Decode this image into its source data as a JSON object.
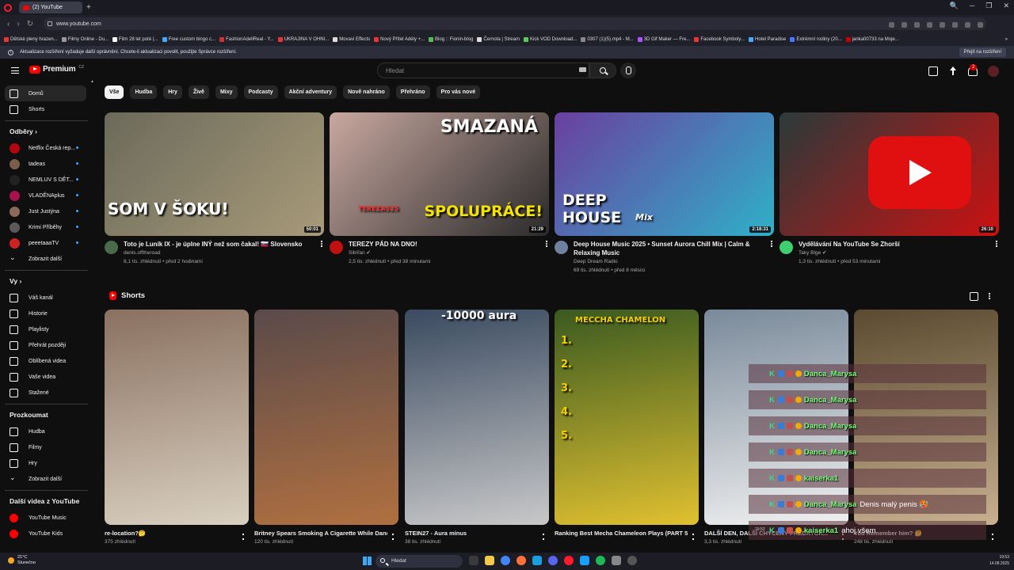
{
  "browser": {
    "tab_title": "(2) YouTube",
    "new_tab": "+",
    "url": "www.youtube.com",
    "window_controls": [
      "🔍",
      "─",
      "❐",
      "✕"
    ],
    "bookmarks": [
      "Dětské pleny hrazen...",
      "Filmy Online - Du...",
      "Film 28 let poté (...",
      "Free custom bingo c...",
      "FashionAdellReal - Y...",
      "UKRAJINA V OHNI...",
      "Movavi Effects",
      "Nový Přítel Adély +...",
      "Blog :: Fionin-blog",
      "Černota | Stream",
      "Kick VOD Download...",
      "0307 (1)(5).mp4 - M...",
      "3D Gif Maker — Fre...",
      "Facebook Symboly...",
      "Hotel Paradise",
      "Extrémní rodiny (20...",
      "janka00733 na Moje..."
    ],
    "bookmarks_more": "»",
    "info_bar_text": "Aktualizace rozšíření vyžaduje další oprávnění. Chcete-li aktualizaci povolit, použijte Správce rozšíření.",
    "info_bar_button": "Přejít na rozšíření"
  },
  "header": {
    "logo_text": "Premium",
    "logo_region": "CZ",
    "search_placeholder": "Hledat",
    "notifications_count": "2"
  },
  "sidebar": {
    "main": [
      {
        "label": "Domů",
        "icon": "home-icon",
        "active": true
      },
      {
        "label": "Shorts",
        "icon": "shorts-icon"
      }
    ],
    "subscriptions_header": "Odběry",
    "subscriptions": [
      {
        "label": "Netflix Česká rep...",
        "color": "#b20710"
      },
      {
        "label": "tadeas",
        "color": "#7a5d4a"
      },
      {
        "label": "NEMLUV S DĚT...",
        "color": "#222"
      },
      {
        "label": "VLADĚNAplus",
        "color": "#a8124c"
      },
      {
        "label": "Just Justýna",
        "color": "#8a6a5a"
      },
      {
        "label": "Krimi Příběhy",
        "color": "#5a5a5a"
      },
      {
        "label": "peeetaaaTV",
        "color": "#c22"
      }
    ],
    "subscriptions_more": "Zobrazit další",
    "you_header": "Vy",
    "you": [
      {
        "label": "Váš kanál",
        "icon": "channel-icon"
      },
      {
        "label": "Historie",
        "icon": "history-icon"
      },
      {
        "label": "Playlisty",
        "icon": "playlists-icon"
      },
      {
        "label": "Přehrát později",
        "icon": "watch-later-icon"
      },
      {
        "label": "Oblíbená videa",
        "icon": "liked-icon"
      },
      {
        "label": "Vaše videa",
        "icon": "your-videos-icon"
      },
      {
        "label": "Stažené",
        "icon": "download-icon"
      }
    ],
    "explore_header": "Prozkoumat",
    "explore": [
      {
        "label": "Hudba",
        "icon": "music-icon"
      },
      {
        "label": "Filmy",
        "icon": "movies-icon"
      },
      {
        "label": "Hry",
        "icon": "gaming-icon"
      }
    ],
    "explore_more": "Zobrazit další",
    "more_header": "Další videa z YouTube",
    "more": [
      {
        "label": "YouTube Music"
      },
      {
        "label": "YouTube Kids"
      }
    ]
  },
  "chips": [
    "Vše",
    "Hudba",
    "Hry",
    "Živě",
    "Mixy",
    "Podcasty",
    "Akční adventury",
    "Nově nahráno",
    "Přehráno",
    "Pro vás nové"
  ],
  "videos": [
    {
      "title": "Toto je Luník IX - je úplne INÝ než som čakal! 🇸🇰 Slovensko",
      "channel": "denis.offtheroad",
      "meta": "8,1 tis. zhlédnutí • před 2 hodinami",
      "duration": "50:01",
      "overlay": "SOM V ŠOKU!",
      "colors": [
        "#6b6a5a",
        "#a89a7a"
      ]
    },
    {
      "title": "TEREZY PÁD NA DNO!",
      "channel": "Sibířan ✔",
      "meta": "2,5 tis. zhlédnutí • před 38 minutami",
      "duration": "21:29",
      "overlay": "SMAZANÁ",
      "overlay2": "SPOLUPRÁCE!",
      "overlay3": "TEREZA525",
      "colors": [
        "#c9a8a0",
        "#2a2a2a"
      ]
    },
    {
      "title": "Deep House Music 2025 • Sunset Aurora Chill Mix | Calm & Relaxing Music",
      "channel": "Deep Dream Radio",
      "meta": "69 tis. zhlédnutí • před 8 měsíci",
      "duration": "2:18:31",
      "overlay": "DEEP",
      "overlay2": "HOUSE",
      "overlay3": "Mix",
      "colors": [
        "#6b3fa0",
        "#2fb0c8"
      ]
    },
    {
      "title": "Vydělávání Na YouTube Se Zhorší",
      "channel": "Taky Blge ✔",
      "meta": "1,3 tis. zhlédnutí • před 53 minutami",
      "duration": "26:10",
      "colors": [
        "#2a3a3a",
        "#cc1111"
      ]
    }
  ],
  "shorts_header": "Shorts",
  "shorts": [
    {
      "title": "re-location?🤔",
      "views": "375 zhlédnutí",
      "colors": [
        "#8a7060",
        "#d9d0c0"
      ]
    },
    {
      "title": "Britney Spears Smoking A Cigarette While Dancing - February 18 2024 🚬",
      "views": "120 tis. zhlédnutí",
      "colors": [
        "#5a4a4a",
        "#b07040"
      ]
    },
    {
      "title": "STEIN27 - Aura mínus",
      "views": "38 tis. zhlédnutí",
      "overlay": "-10000 aura",
      "colors": [
        "#3a4a60",
        "#c8c8c8"
      ]
    },
    {
      "title": "Ranking Best Mecha Chameleon Plays (PART 5) 🐢🎨",
      "views": "",
      "overlay": "MECCHA CHAMELON",
      "ranks": [
        "1.",
        "2.",
        "3.",
        "4.",
        "5."
      ],
      "colors": [
        "#3a5a20",
        "#e0c030"
      ]
    },
    {
      "title": "DALŠÍ DEN, DALŠÍ CHYCENÝ PREDÁTOR...",
      "views": "3,3 tis. zhlédnutí",
      "colors": [
        "#7a8a9a",
        "#f0f0f0"
      ]
    },
    {
      "title": "You Remember him? 🤔",
      "views": "248 tis. zhlédnutí",
      "colors": [
        "#5a4a30",
        "#c8b090"
      ]
    }
  ],
  "chat": [
    {
      "name": "Danca_Marysa",
      "msg": ""
    },
    {
      "name": "Danca_Marysa",
      "msg": ""
    },
    {
      "name": "Danca_Marysa",
      "msg": ""
    },
    {
      "name": "Danca_Marysa",
      "msg": ""
    },
    {
      "name": "kaiserka1",
      "msg": ""
    },
    {
      "name": "Danca_Marysa",
      "msg": "Denis malý penis 🥵"
    },
    {
      "name": "kaiserka1",
      "msg": "ahoj všem"
    }
  ],
  "chat_time": "19:53",
  "taskbar": {
    "weather_temp": "21°C",
    "weather_desc": "Slunečno",
    "search": "Hledat",
    "time": "19:53",
    "date": "14.08.2025"
  }
}
